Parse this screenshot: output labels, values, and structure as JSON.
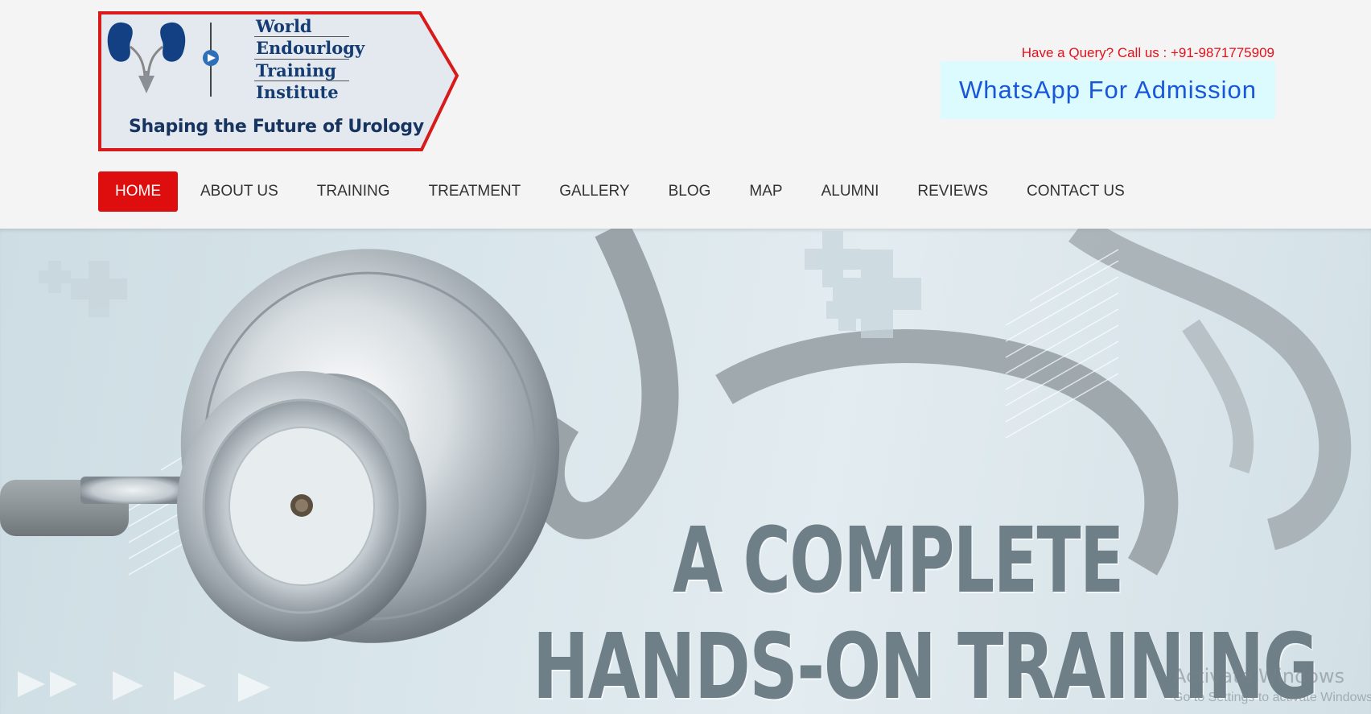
{
  "logo": {
    "lines": [
      "World",
      "Endourlogy",
      "Training",
      "Institute"
    ],
    "tagline": "Shaping the Future of Urology"
  },
  "header": {
    "query": "Have a Query? Call us : +91-9871775909",
    "whatsapp_label": "WhatsApp For Admission"
  },
  "nav": {
    "items": [
      "HOME",
      "ABOUT US",
      "TRAINING",
      "TREATMENT",
      "GALLERY",
      "BLOG",
      "MAP",
      "ALUMNI",
      "REVIEWS",
      "CONTACT US"
    ],
    "active": "HOME"
  },
  "hero": {
    "line1": "A COMPLETE",
    "line2": "HANDS-ON TRAINING"
  },
  "watermark": {
    "title": "Activate Windows",
    "subtitle": "Go to Settings to activate Windows."
  },
  "colors": {
    "accent_red": "#de0d0e",
    "query_red": "#e3111b",
    "whatsapp_bg": "#dbfbff",
    "whatsapp_text": "#1957d8",
    "logo_blue": "#143c72"
  },
  "icons": [
    "kidney-logo-icon",
    "play-arrow-icon",
    "medical-cross-icon",
    "stethoscope-image"
  ]
}
